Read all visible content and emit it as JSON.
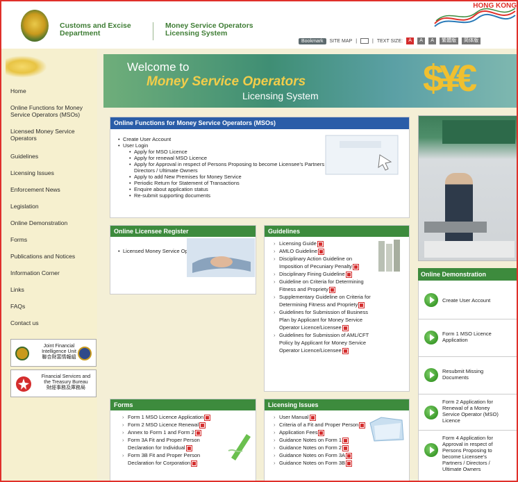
{
  "header": {
    "department": [
      "Customs and Excise",
      "Department"
    ],
    "system": [
      "Money Service Operators",
      "Licensing System"
    ],
    "hk_logo": "HONG KONG",
    "toolbar": {
      "bookmark": "Bookmark",
      "sitemap": "SITE MAP",
      "text_size": "TEXT SIZE:",
      "sizes": [
        "A",
        "A",
        "A"
      ],
      "lang1": "繁體版",
      "lang2": "简体版"
    }
  },
  "sidebar": {
    "items": [
      "Home",
      "Online Functions for Money Service Operators (MSOs)",
      "Licensed Money Service Operators",
      "Guidelines",
      "Licensing Issues",
      "Enforcement News",
      "Legislation",
      "Online Demonstration",
      "Forms",
      "Publications and Notices",
      "Information Corner",
      "Links",
      "FAQs",
      "Contact us"
    ],
    "logo1": [
      "Joint Financial",
      "Intelligence Unit",
      "聯合財富情報組"
    ],
    "logo2": [
      "Financial Services and",
      "the Treasury Bureau",
      "財經事務及庫務局"
    ]
  },
  "banner": {
    "welcome": "Welcome to",
    "name": "Money Service Operators",
    "system": "Licensing System"
  },
  "online_functions": {
    "title": "Online Functions for Money Service Operators (MSOs)",
    "create_account": "Create User Account",
    "user_login": "User Login",
    "sub": [
      "Apply for MSO Licence",
      "Apply for renewal MSO Licence",
      "Apply for Approval in respect of Persons Proposing to become Licensee's Partners /",
      "Directors / Ultimate Owners",
      "Apply to add New Premises for Money Service",
      "Periodic Return for Statement of Transactions",
      "Enquire about application status",
      "Re-submit supporting documents"
    ]
  },
  "licensee_register": {
    "title": "Online Licensee Register",
    "item": "Licensed Money Service Operators"
  },
  "guidelines": {
    "title": "Guidelines",
    "items": [
      [
        "Licensing Guide"
      ],
      [
        "AMLO Guideline"
      ],
      [
        "Disciplinary Action Guideline on",
        "Imposition of Pecuniary Penalty"
      ],
      [
        "Disciplinary Fining Guideline"
      ],
      [
        "Guideline on Criteria for Determining",
        "Fitness and Propriety"
      ],
      [
        "Supplementary Guideline on Criteria for",
        "Determining Fitness and Propriety"
      ],
      [
        "Guidelines for Submission of Business",
        "Plan by Applicant for Money Service",
        "Operator Licence/Licensee"
      ],
      [
        "Guidelines for Submission of AML/CFT",
        "Policy by Applicant for Money Service",
        "Operator Licence/Licensee"
      ]
    ]
  },
  "forms": {
    "title": "Forms",
    "items": [
      [
        "Form 1 MSO Licence Application"
      ],
      [
        "Form 2 MSO Licence Renewal"
      ],
      [
        "Annex to Form 1 and Form 2"
      ],
      [
        "Form 3A Fit and Proper Person",
        "Declaration for Individual"
      ],
      [
        "Form 3B Fit and Proper Person",
        "Declaration for Corporation"
      ]
    ]
  },
  "licensing_issues": {
    "title": "Licensing Issues",
    "items": [
      "User Manual",
      "Criteria of a Fit and Proper Person",
      "Application Fees",
      "Guidance Notes on Form 1",
      "Guidance Notes on Form 2",
      "Guidance Notes on Form 3A",
      "Guidance Notes on Form 3B"
    ]
  },
  "online_demo": {
    "title": "Online Demonstration",
    "items": [
      [
        "Create User Account"
      ],
      [
        "Form 1 MSO Licence",
        "Application"
      ],
      [
        "Resubmit Missing",
        "Documents"
      ],
      [
        "Form 2 Application for",
        "Renewal of a Money",
        "Service Operator (MSO)",
        "Licence"
      ],
      [
        "Form 4 Application for",
        "Approval in respect of",
        "Persons Proposing to",
        "become Licensee's",
        "Partners / Directors /",
        "Ultimate Owners"
      ]
    ]
  },
  "colors": {
    "border": "#e0302a",
    "green_header": "#3d8b3d",
    "blue_header": "#2a5da8",
    "sidebar_bg": "#f6f0cf",
    "page_bg": "#f4efd6"
  }
}
